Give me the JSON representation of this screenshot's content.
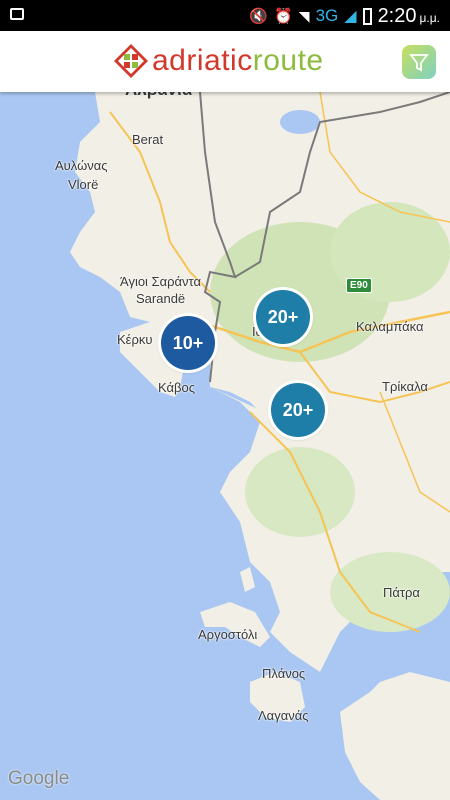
{
  "status_bar": {
    "network": "3G",
    "time": "2:20",
    "ampm": "μ.μ."
  },
  "app": {
    "logo_part1": "adriatic",
    "logo_part2": "route",
    "logo_icon": "adriatic-route-logo-icon",
    "filter_icon": "filter-funnel-icon",
    "brand_colors": {
      "red": "#d0392c",
      "green": "#8dbb3e"
    }
  },
  "map": {
    "labels": {
      "albania": "Αλβανία",
      "berat": "Berat",
      "avlonas": "Αυλώνας",
      "vlore": "Vlorë",
      "agioi_saranta": "Άγιοι Σαράντα",
      "sarande": "Sarandë",
      "kerkyra": "Κέρκυ",
      "kavos": "Κάβος",
      "ioannina": "Ιω",
      "kalampaka": "Καλαμπάκα",
      "trikala": "Τρίκαλα",
      "argostoli": "Αργοστόλι",
      "patra": "Πάτρα",
      "planos": "Πλάνος",
      "laganas": "Λαγανάς"
    },
    "road_badge": "E90",
    "attribution": "Google",
    "clusters": [
      {
        "label": "10+",
        "color": "#1e5aa0"
      },
      {
        "label": "20+",
        "color": "#1f7ea7"
      },
      {
        "label": "20+",
        "color": "#1f7ea7"
      }
    ]
  }
}
